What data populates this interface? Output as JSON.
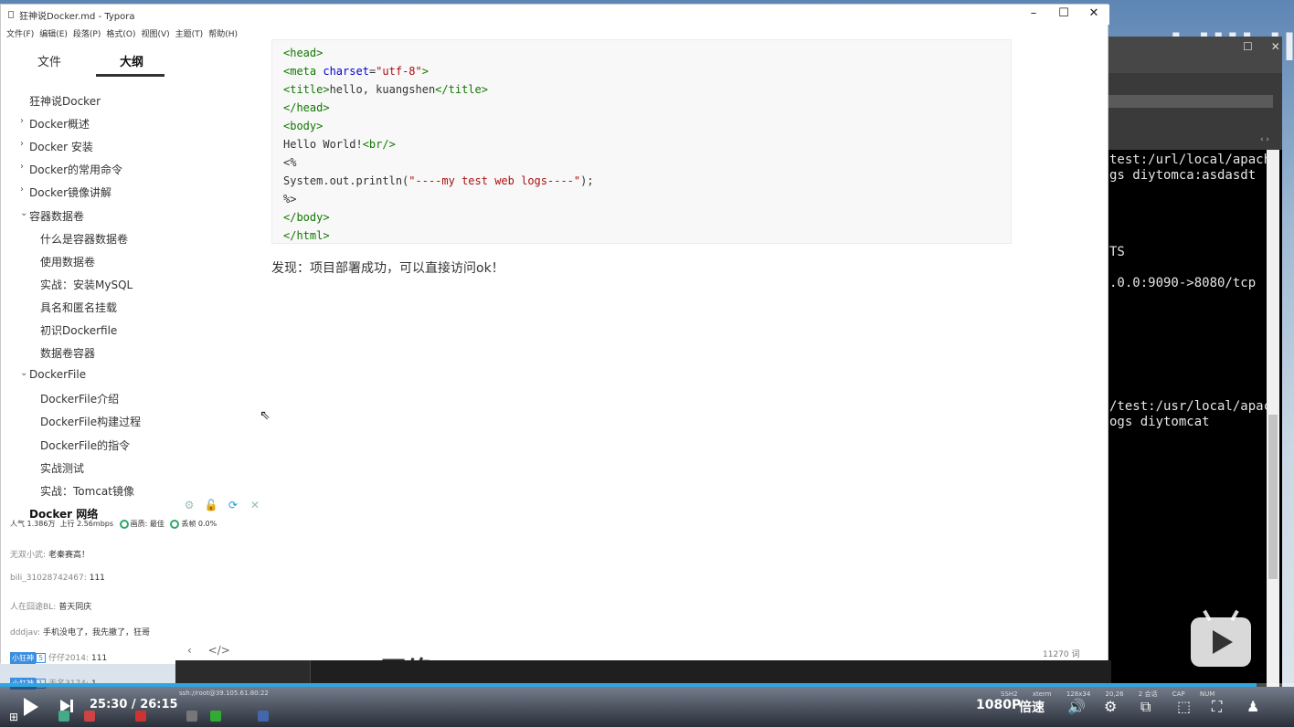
{
  "window": {
    "title": "狂神说Docker.md - Typora",
    "minimize": "–",
    "maximize": "☐",
    "close": "✕"
  },
  "menu": [
    "文件(F)",
    "编辑(E)",
    "段落(P)",
    "格式(O)",
    "视图(V)",
    "主题(T)",
    "帮助(H)"
  ],
  "sidebar": {
    "tabs": [
      "文件",
      "大纲"
    ],
    "active_tab": "大纲",
    "outline": [
      {
        "label": "狂神说Docker",
        "level": 0,
        "caret": ""
      },
      {
        "label": "Docker概述",
        "level": 1,
        "caret": "›"
      },
      {
        "label": "Docker 安装",
        "level": 1,
        "caret": "›"
      },
      {
        "label": "Docker的常用命令",
        "level": 1,
        "caret": "›"
      },
      {
        "label": "Docker镜像讲解",
        "level": 1,
        "caret": "›"
      },
      {
        "label": "容器数据卷",
        "level": 1,
        "caret": "⌄"
      },
      {
        "label": "什么是容器数据卷",
        "level": 2,
        "caret": ""
      },
      {
        "label": "使用数据卷",
        "level": 2,
        "caret": ""
      },
      {
        "label": "实战：安装MySQL",
        "level": 2,
        "caret": ""
      },
      {
        "label": "具名和匿名挂载",
        "level": 2,
        "caret": ""
      },
      {
        "label": "初识Dockerfile",
        "level": 2,
        "caret": ""
      },
      {
        "label": "数据卷容器",
        "level": 2,
        "caret": ""
      },
      {
        "label": "DockerFile",
        "level": 1,
        "caret": "⌄"
      },
      {
        "label": "DockerFile介绍",
        "level": 2,
        "caret": ""
      },
      {
        "label": "DockerFile构建过程",
        "level": 2,
        "caret": ""
      },
      {
        "label": "DockerFile的指令",
        "level": 2,
        "caret": ""
      },
      {
        "label": "实战测试",
        "level": 2,
        "caret": ""
      },
      {
        "label": "实战：Tomcat镜像",
        "level": 2,
        "caret": ""
      },
      {
        "label": "Docker 网络",
        "level": 1,
        "caret": ""
      }
    ]
  },
  "live": {
    "popularity": "人气  1.386万",
    "upload": "上行  2.56mbps",
    "quality": "画质: 最佳",
    "drop": "丢帧 0.0%",
    "danmaku": [
      {
        "user": "无双小武:",
        "text": "老秦赛高！"
      },
      {
        "user": "bili_31028742467:",
        "text": "111"
      },
      {
        "user": "人在囧途BL:",
        "text": "普天同庆"
      },
      {
        "user": "dddjav:",
        "text": "手机没电了，我先撤了，狂哥"
      },
      {
        "badge": "小狂神",
        "level": "5",
        "user": "仔仔2014:",
        "text": "111"
      },
      {
        "badge": "小狂神",
        "level": "1",
        "user": "无名3174:",
        "text": "1"
      }
    ]
  },
  "code_lines": [
    "<head>",
    "<meta charset=\"utf-8\">",
    "<title>hello, kuangshen</title>",
    "</head>",
    "<body>",
    "Hello World!<br/>",
    "<%",
    "System.out.println(\"----my test web logs----\");",
    "%>",
    "</body>",
    "</html>"
  ],
  "paragraph": "发现：项目部署成功，可以直接访问ok！",
  "partial_heading": "Docker 网络",
  "word_count": "11270 词",
  "footer": {
    "back": "‹",
    "source": "</>"
  },
  "terminal": {
    "lines": [
      "test:/url/local/apach",
      "gs diytomca:asdasdt",
      "TS",
      ".0.0:9090->8080/tcp",
      "/test:/usr/local/apac",
      "ogs diytomcat"
    ]
  },
  "status": {
    "ssh": "ssh://root@39.105.61.80:22",
    "protocol": "SSH2",
    "term": "xterm",
    "size": "128x34",
    "pos": "20,26",
    "sessions": "2 会话",
    "caps": "CAP",
    "num": "NUM"
  },
  "player": {
    "current": "25:30",
    "total": "26:15",
    "progress": 0.971,
    "quality_label": "1080P",
    "speed_label": "倍速"
  },
  "watermark": "Java bilibili",
  "colors": {
    "accent": "#2fa6e0",
    "tag": "#117700",
    "string": "#aa1111"
  }
}
